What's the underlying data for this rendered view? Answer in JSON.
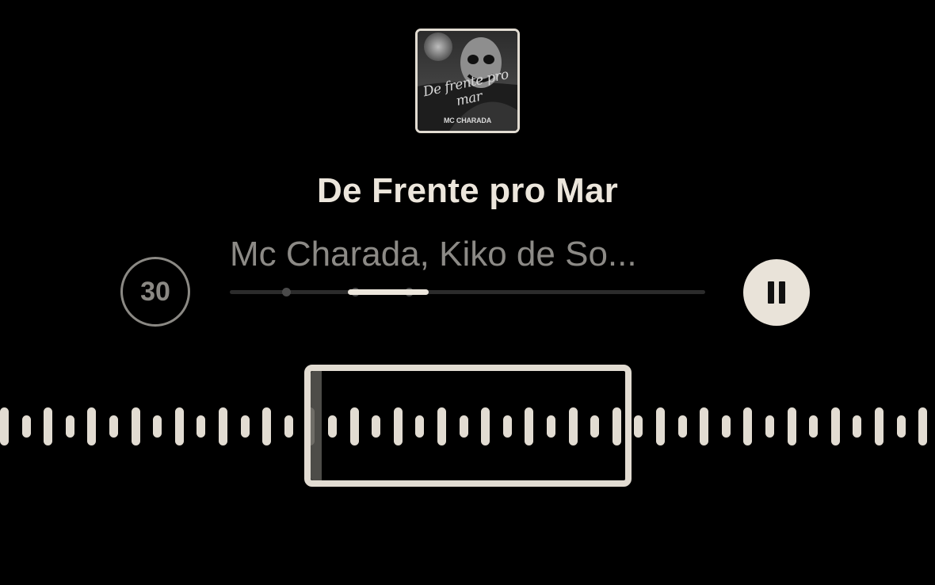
{
  "album": {
    "script_title": "De frente pro mar",
    "artist_logo": "MC CHARADA"
  },
  "track": {
    "title": "De Frente pro Mar",
    "artists": "Mc Charada, Kiko de So..."
  },
  "controls": {
    "skip_label": "30",
    "skip_icon": "skip-30-icon",
    "pause_icon": "pause-icon"
  },
  "progress": {
    "position_fraction": 0.25
  },
  "colors": {
    "background": "#000000",
    "foreground": "#ece6dc",
    "secondary_text": "#8c8a86",
    "track": "#2b2b2b"
  },
  "waveform": {
    "selection_label": ""
  }
}
